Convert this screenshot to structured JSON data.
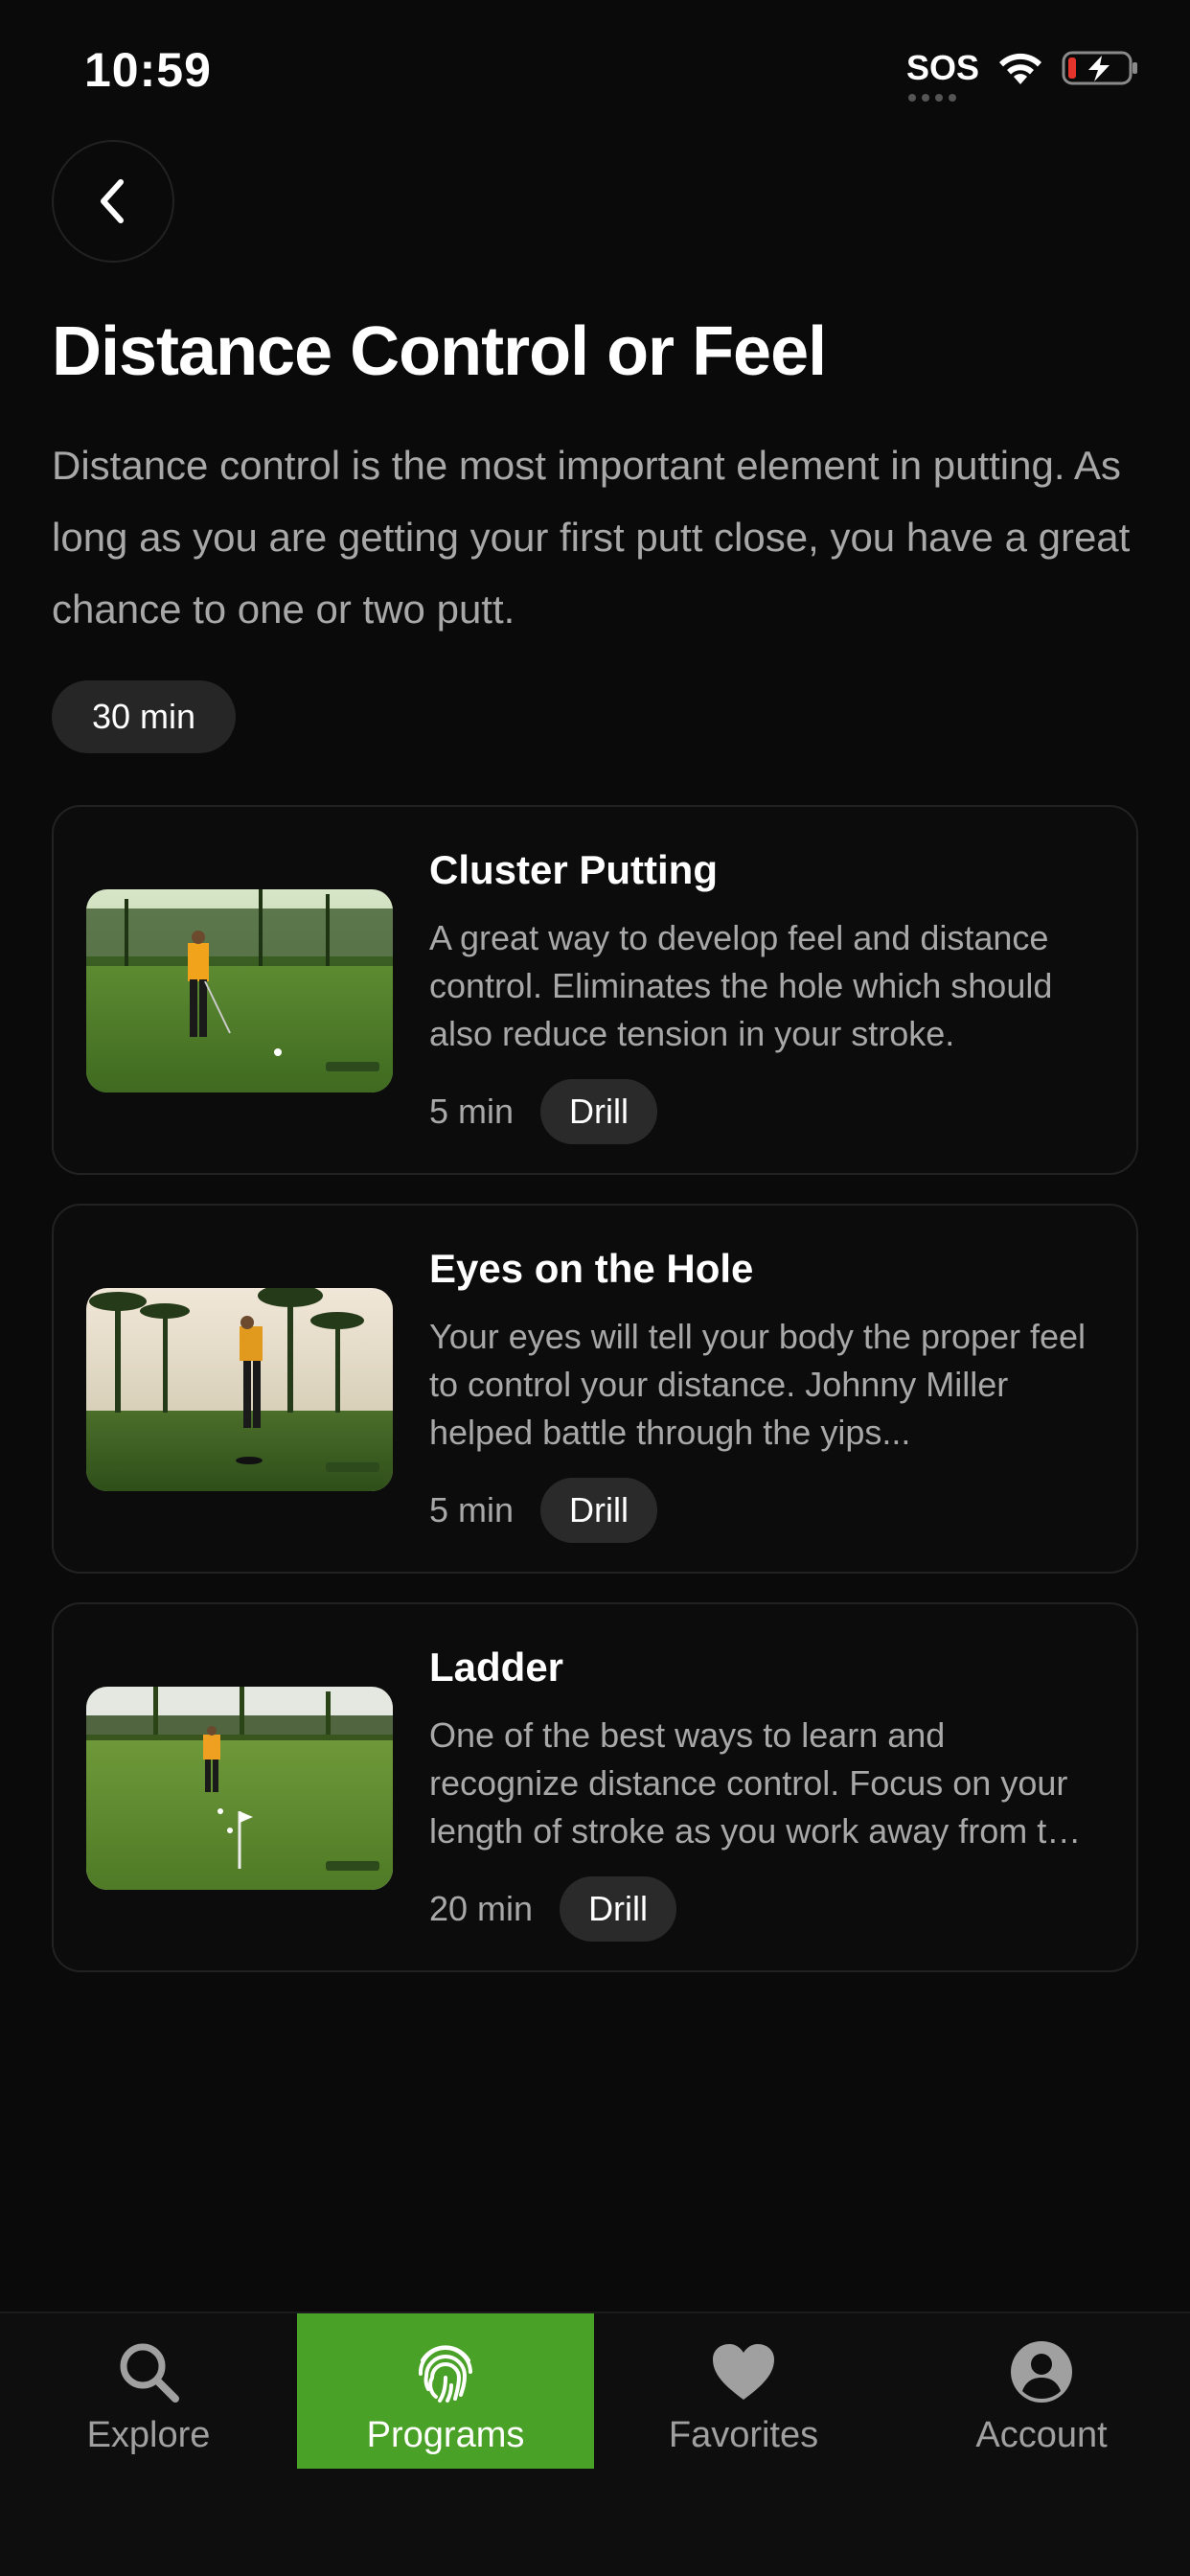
{
  "status_bar": {
    "time": "10:59",
    "sos": "SOS"
  },
  "program": {
    "title": "Distance Control or Feel",
    "description": "Distance control is the most important element in putting.  As long as you are getting your first putt close, you have a great chance to one or two putt.",
    "duration": "30 min"
  },
  "drills": [
    {
      "title": "Cluster Putting",
      "description": "A great way to develop feel and distance control.  Eliminates the hole which should also reduce tension in your stroke.",
      "time": "5 min",
      "tag": "Drill"
    },
    {
      "title": "Eyes on the Hole",
      "description": "Your eyes will tell your body the proper feel to control your distance.  Johnny Miller helped battle through the yips...",
      "time": "5 min",
      "tag": "Drill"
    },
    {
      "title": "Ladder",
      "description": "One of the best ways to learn and recognize distance control.  Focus on your length of stroke as you work away from the hole.",
      "time": "20 min",
      "tag": "Drill"
    }
  ],
  "tabs": [
    {
      "label": "Explore",
      "icon": "search-icon"
    },
    {
      "label": "Programs",
      "icon": "fingerprint-icon",
      "active": true
    },
    {
      "label": "Favorites",
      "icon": "heart-icon"
    },
    {
      "label": "Account",
      "icon": "account-icon"
    }
  ],
  "colors": {
    "accent": "#4aa127",
    "background": "#0a0a0a",
    "chip": "#262626"
  }
}
